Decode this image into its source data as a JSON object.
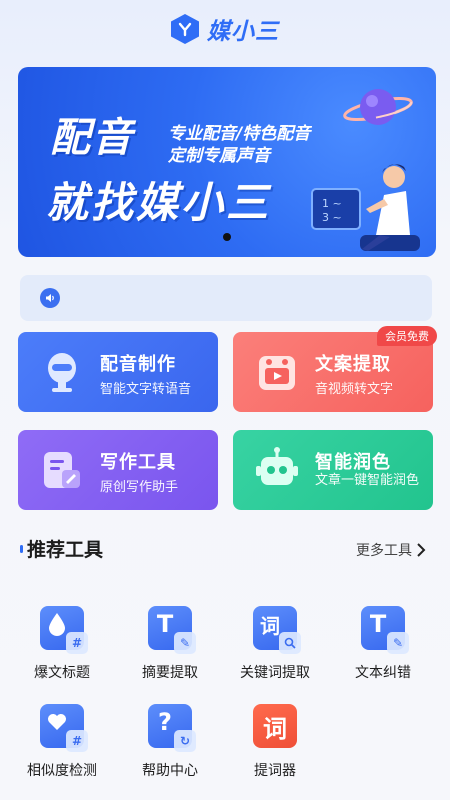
{
  "header": {
    "app_name": "媒小三"
  },
  "banner": {
    "headline_1": "配音",
    "headline_2": "就找媒小三",
    "tagline_1": "专业配音/特色配音",
    "tagline_2": "定制专属声音"
  },
  "feature_cards": [
    {
      "title": "配音制作",
      "desc": "智能文字转语音"
    },
    {
      "title": "文案提取",
      "desc": "音视频转文字",
      "badge": "会员免费"
    },
    {
      "title": "写作工具",
      "desc": "原创写作助手"
    },
    {
      "title": "智能润色",
      "desc": "文章一键智能润色"
    }
  ],
  "recommended": {
    "title": "推荐工具",
    "more_label": "更多工具",
    "tools": [
      {
        "label": "爆文标题",
        "icon": "drop-hash-icon"
      },
      {
        "label": "摘要提取",
        "icon": "t-edit-icon"
      },
      {
        "label": "关键词提取",
        "icon": "ci-search-icon"
      },
      {
        "label": "文本纠错",
        "icon": "t-pen-icon"
      },
      {
        "label": "相似度检测",
        "icon": "heart-compare-icon"
      },
      {
        "label": "帮助中心",
        "icon": "question-refresh-icon"
      },
      {
        "label": "提词器",
        "icon": "ci-red-icon"
      }
    ]
  },
  "colors": {
    "brand": "#2f6df6",
    "card_blue": "#4c7dfa",
    "card_red": "#f6625e",
    "card_purple": "#7a55ee",
    "card_green": "#22c48e",
    "badge_red": "#f04848"
  }
}
